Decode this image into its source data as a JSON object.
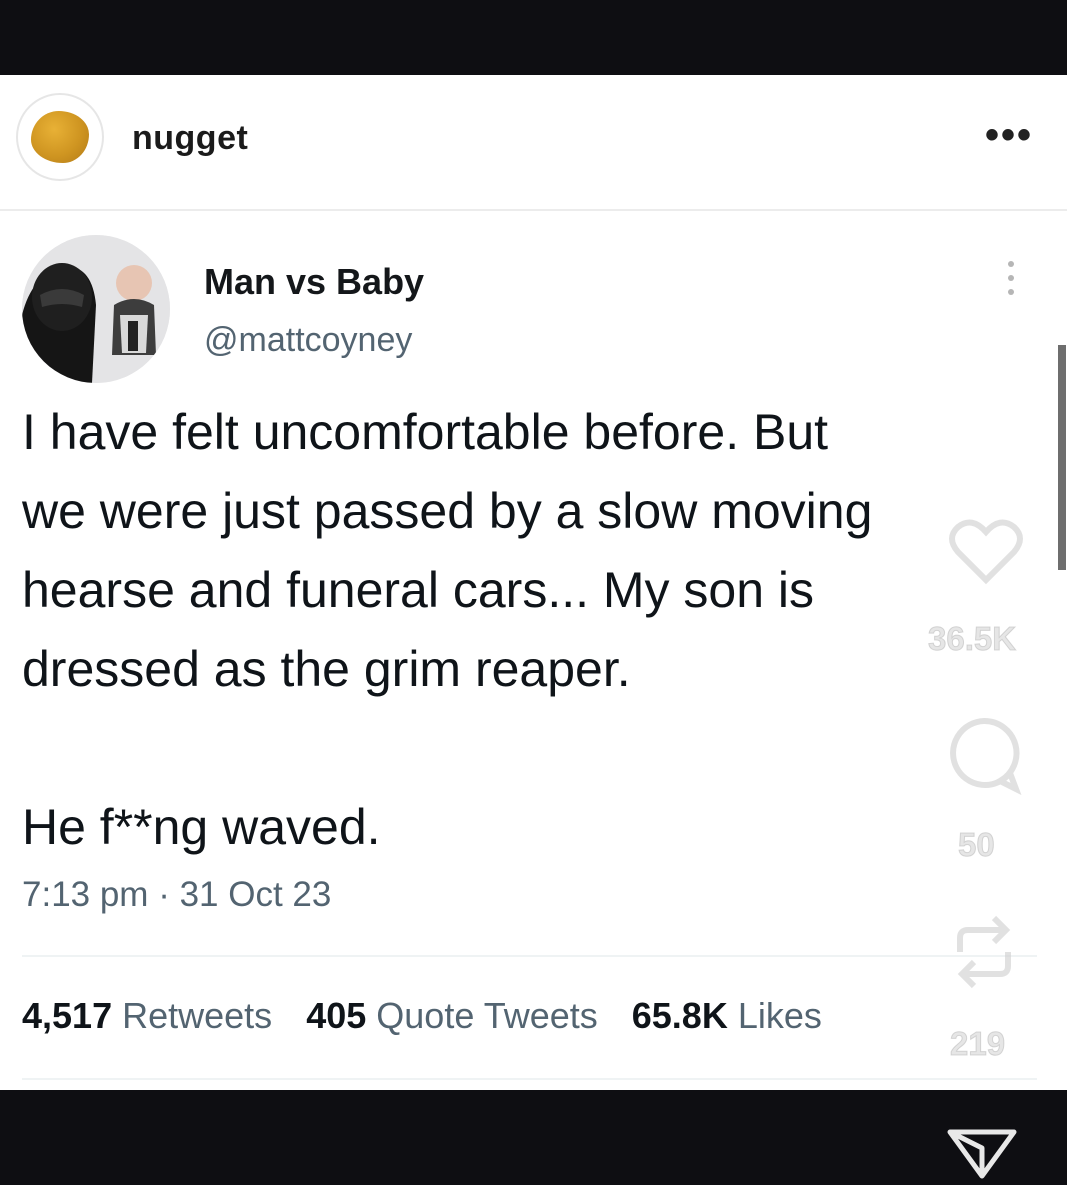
{
  "post": {
    "account_name": "nugget",
    "more_label": "•••"
  },
  "tweet": {
    "display_name": "Man vs Baby",
    "handle": "@mattcoyney",
    "text_lines": [
      "I have felt uncomfortable before. But",
      "we were just passed by a slow moving",
      "hearse and funeral cars... My son is",
      "dressed as the grim reaper."
    ],
    "text_last": "He f**ng waved.",
    "timestamp": "7:13 pm · 31 Oct 23",
    "stats": {
      "retweets_count": "4,517",
      "retweets_label": "Retweets",
      "quotes_count": "405",
      "quotes_label": "Quote Tweets",
      "likes_count": "65.8K",
      "likes_label": "Likes"
    }
  },
  "overlay": {
    "likes": "36.5K",
    "comments": "50",
    "reposts": "219"
  },
  "colors": {
    "bar_bg": "#0e0e12",
    "name": "#14171a",
    "secondary": "#536471"
  }
}
